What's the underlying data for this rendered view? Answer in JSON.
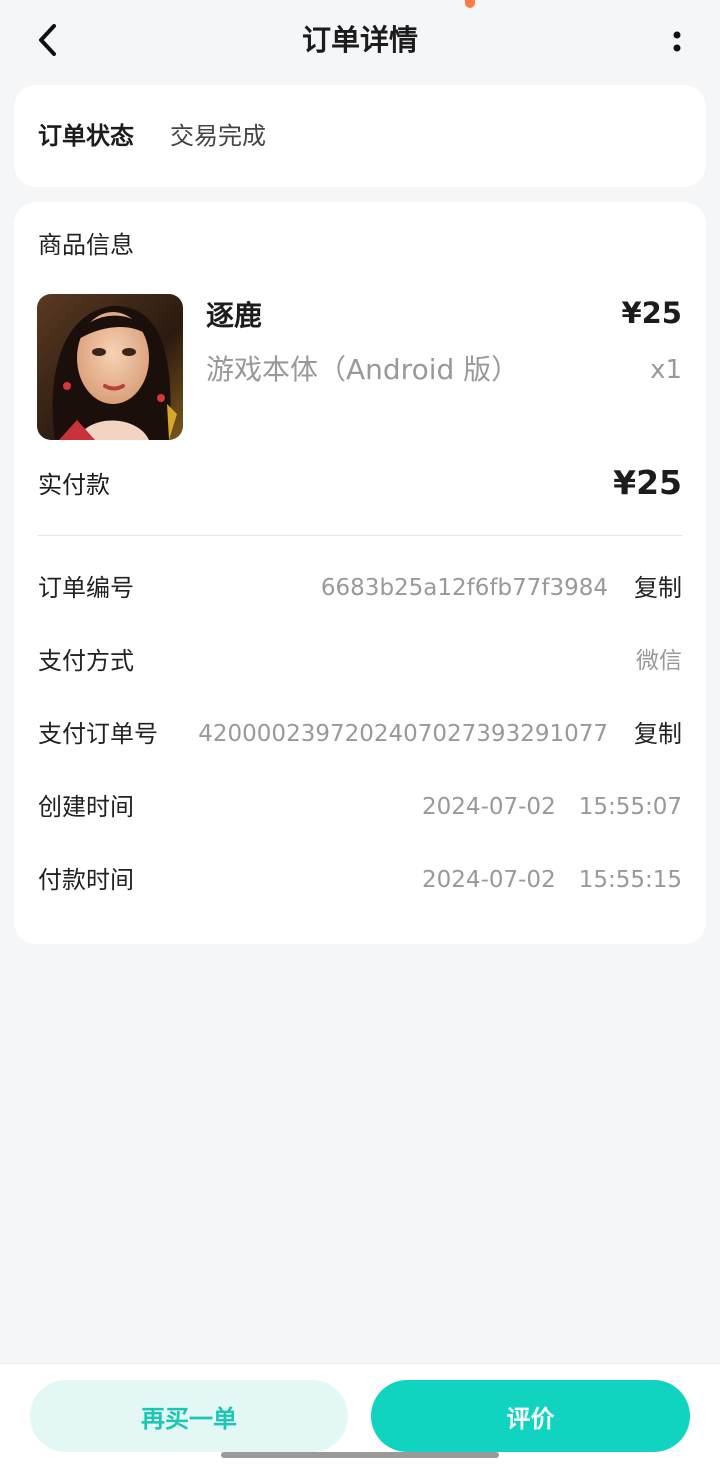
{
  "header": {
    "title": "订单详情",
    "back_icon": "chevron-left-icon",
    "more_icon": "more-vertical-icon"
  },
  "status": {
    "label": "订单状态",
    "value": "交易完成"
  },
  "product_section": {
    "title": "商品信息",
    "name": "逐鹿",
    "price": "¥25",
    "spec": "游戏本体（Android 版）",
    "quantity": "x1"
  },
  "payment": {
    "label": "实付款",
    "value": "¥25"
  },
  "details": {
    "order_no": {
      "label": "订单编号",
      "value": "6683b25a12f6fb77f3984",
      "action": "复制"
    },
    "pay_method": {
      "label": "支付方式",
      "value": "微信"
    },
    "pay_order_no": {
      "label": "支付订单号",
      "value": "4200002397202407027393291077",
      "action": "复制"
    },
    "created_at": {
      "label": "创建时间",
      "value": "2024-07-02　15:55:07"
    },
    "paid_at": {
      "label": "付款时间",
      "value": "2024-07-02　15:55:15"
    }
  },
  "actions": {
    "rebuy": "再买一单",
    "review": "评价"
  },
  "colors": {
    "accent": "#10d4bf",
    "accent_light": "#e3f7f5",
    "background": "#f5f6f8"
  }
}
